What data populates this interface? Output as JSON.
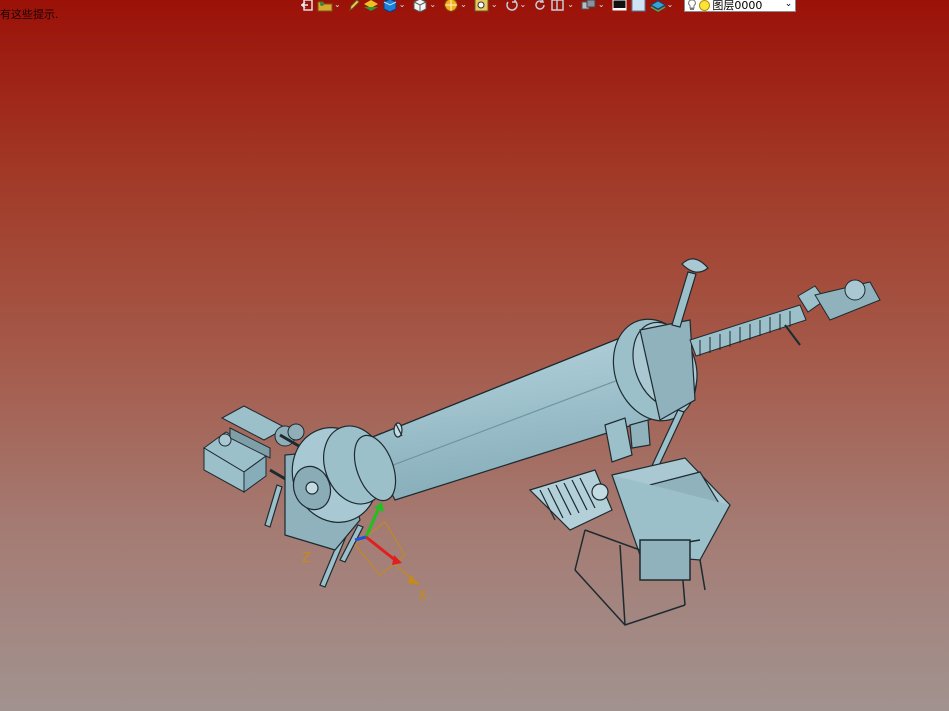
{
  "hint": {
    "line1": "",
    "line2": "有这些提示."
  },
  "toolbar": {
    "items": [
      {
        "name": "exit-icon",
        "has_dropdown": false
      },
      {
        "name": "open-icon",
        "has_dropdown": true
      },
      {
        "name": "pencil-icon",
        "has_dropdown": false
      },
      {
        "name": "layers-icon",
        "has_dropdown": false
      },
      {
        "name": "solid-box-icon",
        "has_dropdown": true
      },
      {
        "name": "view-cube-icon",
        "has_dropdown": true
      },
      {
        "name": "render-mode-icon",
        "has_dropdown": true
      },
      {
        "name": "zoom-fit-icon",
        "has_dropdown": true
      },
      {
        "name": "orbit-icon",
        "has_dropdown": true
      },
      {
        "name": "rotate-icon",
        "has_dropdown": false
      },
      {
        "name": "section-icon",
        "has_dropdown": true
      },
      {
        "name": "hide-show-icon",
        "has_dropdown": true
      },
      {
        "name": "color-swatch-icon",
        "has_dropdown": false
      },
      {
        "name": "background-icon",
        "has_dropdown": false
      },
      {
        "name": "material-icon",
        "has_dropdown": true
      }
    ],
    "layer_select": {
      "value": "图层0000"
    }
  },
  "viewport": {
    "axis": {
      "x_label": "X",
      "z_label": "Z"
    },
    "colors": {
      "background_top": "#9b1108",
      "background_bottom": "#a2928f",
      "model_body": "#9cc3cf",
      "axis_x": "#e02020",
      "axis_y": "#20c020",
      "axis_z": "#2050e0"
    }
  }
}
